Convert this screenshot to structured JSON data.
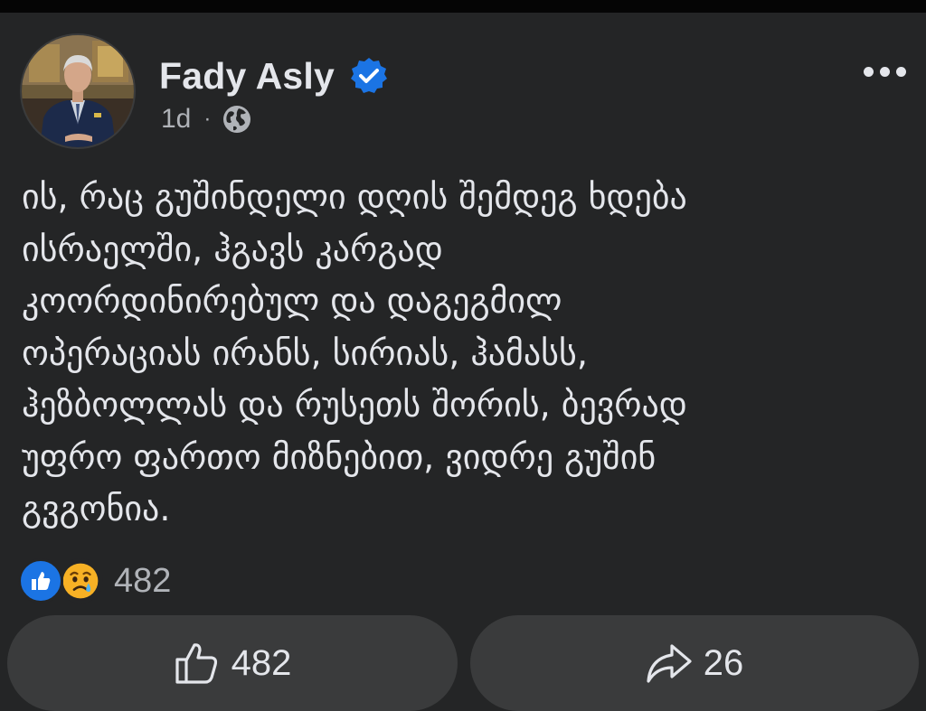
{
  "post": {
    "author": "Fady Asly",
    "verified": true,
    "timestamp": "1d",
    "separator": "·",
    "audience_icon": "globe-icon",
    "text_lines": [
      "ის, რაც გუშინდელი დღის შემდეგ ხდება",
      "ისრაელში, ჰგავს კარგად",
      "კოორდინირებულ და დაგეგმილ",
      "ოპერაციას ირანს, სირიას, ჰამასს,",
      "ჰეზბოლლას და რუსეთს შორის, ბევრად",
      "უფრო ფართო მიზნებით, ვიდრე გუშინ",
      "გვგონია."
    ]
  },
  "reactions": {
    "icons": [
      "like-reaction-icon",
      "sad-reaction-icon"
    ],
    "count": "482"
  },
  "actions": {
    "like_count": "482",
    "share_count": "26"
  },
  "colors": {
    "background": "#242526",
    "button": "#3a3b3c",
    "text_primary": "#e4e6eb",
    "text_secondary": "#b0b3b8",
    "accent": "#1b74e4"
  }
}
